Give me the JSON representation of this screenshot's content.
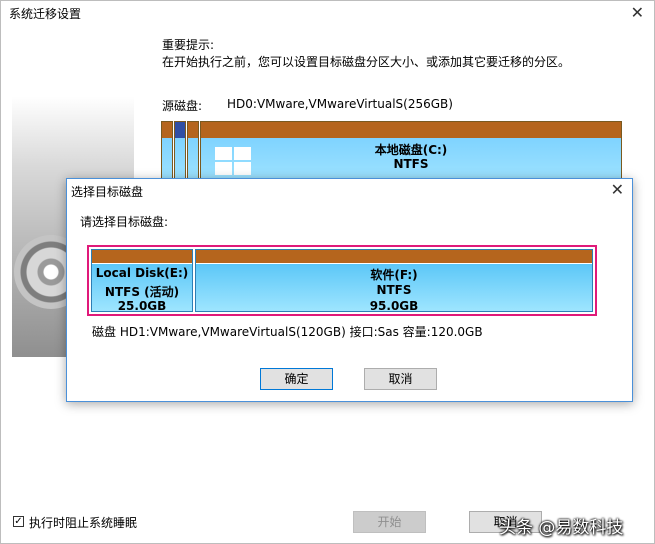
{
  "window": {
    "title": "系统迁移设置",
    "close_glyph": "✕"
  },
  "tip": {
    "heading": "重要提示:",
    "body": "在开始执行之前，您可以设置目标磁盘分区大小、或添加其它要迁移的分区。"
  },
  "source": {
    "label": "源磁盘:",
    "value": "HD0:VMware,VMwareVirtualS(256GB)",
    "main_partition": {
      "name": "本地磁盘(C:)",
      "fs": "NTFS"
    }
  },
  "dialog": {
    "title": "选择目标磁盘",
    "close_glyph": "✕",
    "prompt": "请选择目标磁盘:",
    "partitions": [
      {
        "name": "Local Disk(E:)",
        "fs": "NTFS (活动)",
        "size": "25.0GB"
      },
      {
        "name": "软件(F:)",
        "fs": "NTFS",
        "size": "95.0GB"
      }
    ],
    "disk_info": "磁盘 HD1:VMware,VMwareVirtualS(120GB)  接口:Sas  容量:120.0GB",
    "ok_label": "确定",
    "cancel_label": "取消"
  },
  "footer": {
    "checkbox_checked": true,
    "checkbox_glyph": "✓",
    "checkbox_label": "执行时阻止系统睡眠",
    "start_label": "开始",
    "cancel_label": "取消"
  },
  "watermark": "头条 @易数科技",
  "colors": {
    "accent": "#0078d7",
    "partition_header": "#b5651d",
    "partition_fill": "#7fd3ff",
    "highlight_border": "#e0197a"
  }
}
